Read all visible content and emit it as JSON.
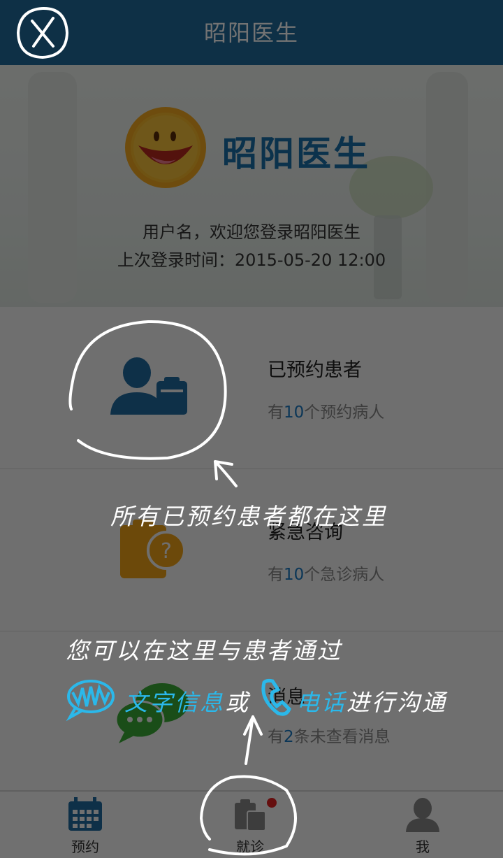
{
  "header": {
    "title": "昭阳医生"
  },
  "hero": {
    "logo_text": "昭阳医生",
    "welcome": "用户名，欢迎您登录昭阳医生",
    "last_login": "上次登录时间：2015-05-20  12:00"
  },
  "rows": [
    {
      "title": "已预约患者",
      "sub_prefix": "有",
      "count": "10",
      "sub_suffix": "个预约病人",
      "icon": "patient-clipboard-icon",
      "color": "#1f6aa0"
    },
    {
      "title": "紧急咨询",
      "sub_prefix": "有",
      "count": "10",
      "sub_suffix": "个急诊病人",
      "icon": "question-clipboard-icon",
      "color": "#f0a318"
    },
    {
      "title": "消息",
      "sub_prefix": "有",
      "count": "2",
      "sub_suffix": "条未查看消息",
      "icon": "chat-bubbles-icon",
      "color": "#3aaa35"
    }
  ],
  "tabbar": {
    "tabs": [
      {
        "label": "预约",
        "icon": "calendar-icon",
        "color": "#1f6aa0"
      },
      {
        "label": "就诊",
        "icon": "clipboard-icon",
        "color": "#888888",
        "badge": true
      },
      {
        "label": "我",
        "icon": "person-icon",
        "color": "#888888"
      }
    ]
  },
  "tutorial": {
    "close_icon": "close-icon",
    "note_appointments": "所有已预约患者都在这里",
    "note_line1": "您可以在这里与患者通过",
    "note_line2_text": "文字信息",
    "note_line2_or": "或",
    "note_line2_phone": "电话",
    "note_line2_end": "进行沟通"
  },
  "colors": {
    "brand": "#1f6a9c",
    "accent": "#1a78c2",
    "overlay": "rgba(0,0,0,0.55)"
  }
}
